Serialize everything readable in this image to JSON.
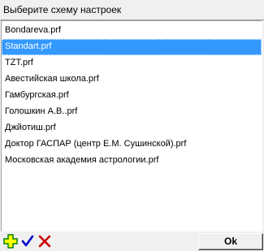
{
  "window": {
    "title": "Выберите схему настроек"
  },
  "list": {
    "items": [
      "Bondareva.prf",
      "Standart.prf",
      "TZT.prf",
      "Авестийская школа.prf",
      "Гамбургская.prf",
      "Голошкин А.В..prf",
      "Джйотиш.prf",
      "Доктор ГАСПАР (центр Е.М. Сушинской).prf",
      "Московская академия астрологии.prf"
    ],
    "selected_index": 1
  },
  "toolbar": {
    "add_icon": "add-plus-icon",
    "confirm_icon": "checkmark-icon",
    "delete_icon": "delete-x-icon",
    "ok_label": "Ok"
  },
  "colors": {
    "selection": "#3399ff",
    "add_icon_fill": "#ffff00",
    "add_icon_border": "#008000",
    "check_icon": "#0000cc",
    "delete_icon": "#cc0000"
  }
}
